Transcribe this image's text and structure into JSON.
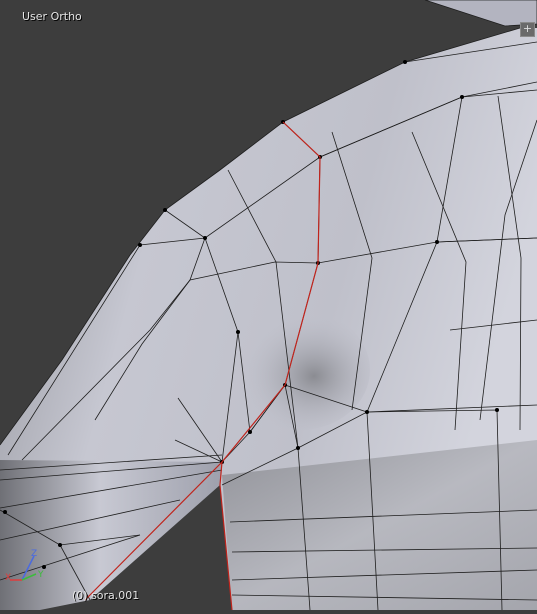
{
  "viewport": {
    "view_name": "User Ortho",
    "object_label": "(0) sora.001",
    "corner_widget_symbol": "+"
  },
  "axes_gizmo": {
    "x_label": "X",
    "y_label": "Y",
    "z_label": "Z",
    "x_color": "#e03c3c",
    "y_color": "#3cbc3c",
    "z_color": "#4a6ae0"
  },
  "colors": {
    "background": "#3d3d3d",
    "mesh_light": "#c9cad6",
    "mesh_mid": "#a6a7ae",
    "mesh_dark": "#7c7d83",
    "wire": "#1e1e1e",
    "seam": "#c0241c"
  }
}
